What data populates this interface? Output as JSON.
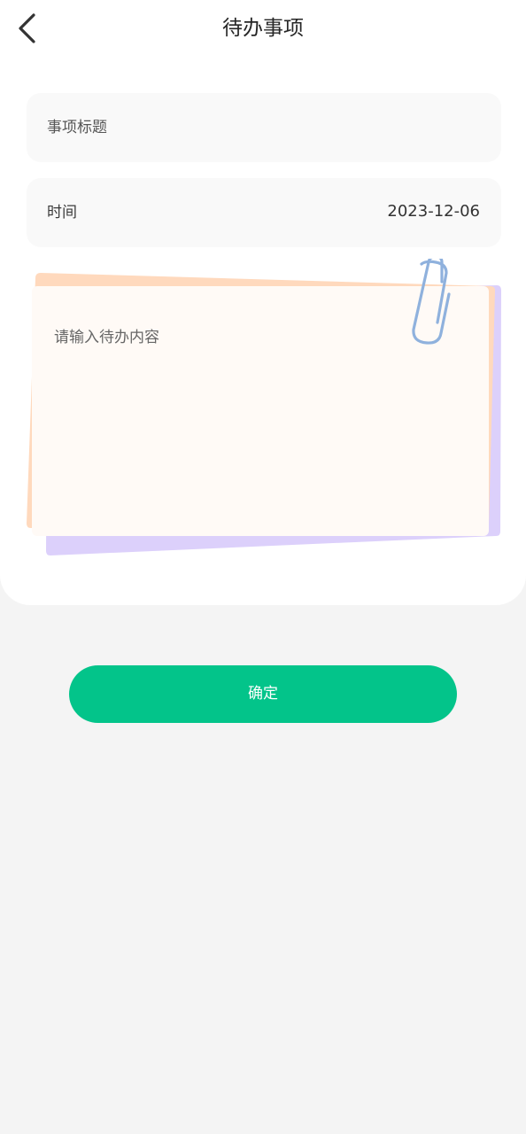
{
  "header": {
    "title": "待办事项",
    "back_icon": "chevron-left-icon"
  },
  "form": {
    "title_field": {
      "placeholder": "事项标题"
    },
    "time_field": {
      "label": "时间",
      "value": "2023-12-06"
    },
    "content_field": {
      "placeholder": "请输入待办内容",
      "decoration_icon": "paperclip-icon"
    }
  },
  "actions": {
    "confirm_label": "确定"
  },
  "colors": {
    "accent": "#03c48a",
    "page_background": "#f4f4f4",
    "card_background": "#ffffff",
    "field_background": "#f9f9f9",
    "note_orange": "#ffd9bd",
    "note_purple": "#dcd0fb",
    "note_paper": "#fffaf6",
    "paperclip": "#8fb1dd"
  }
}
